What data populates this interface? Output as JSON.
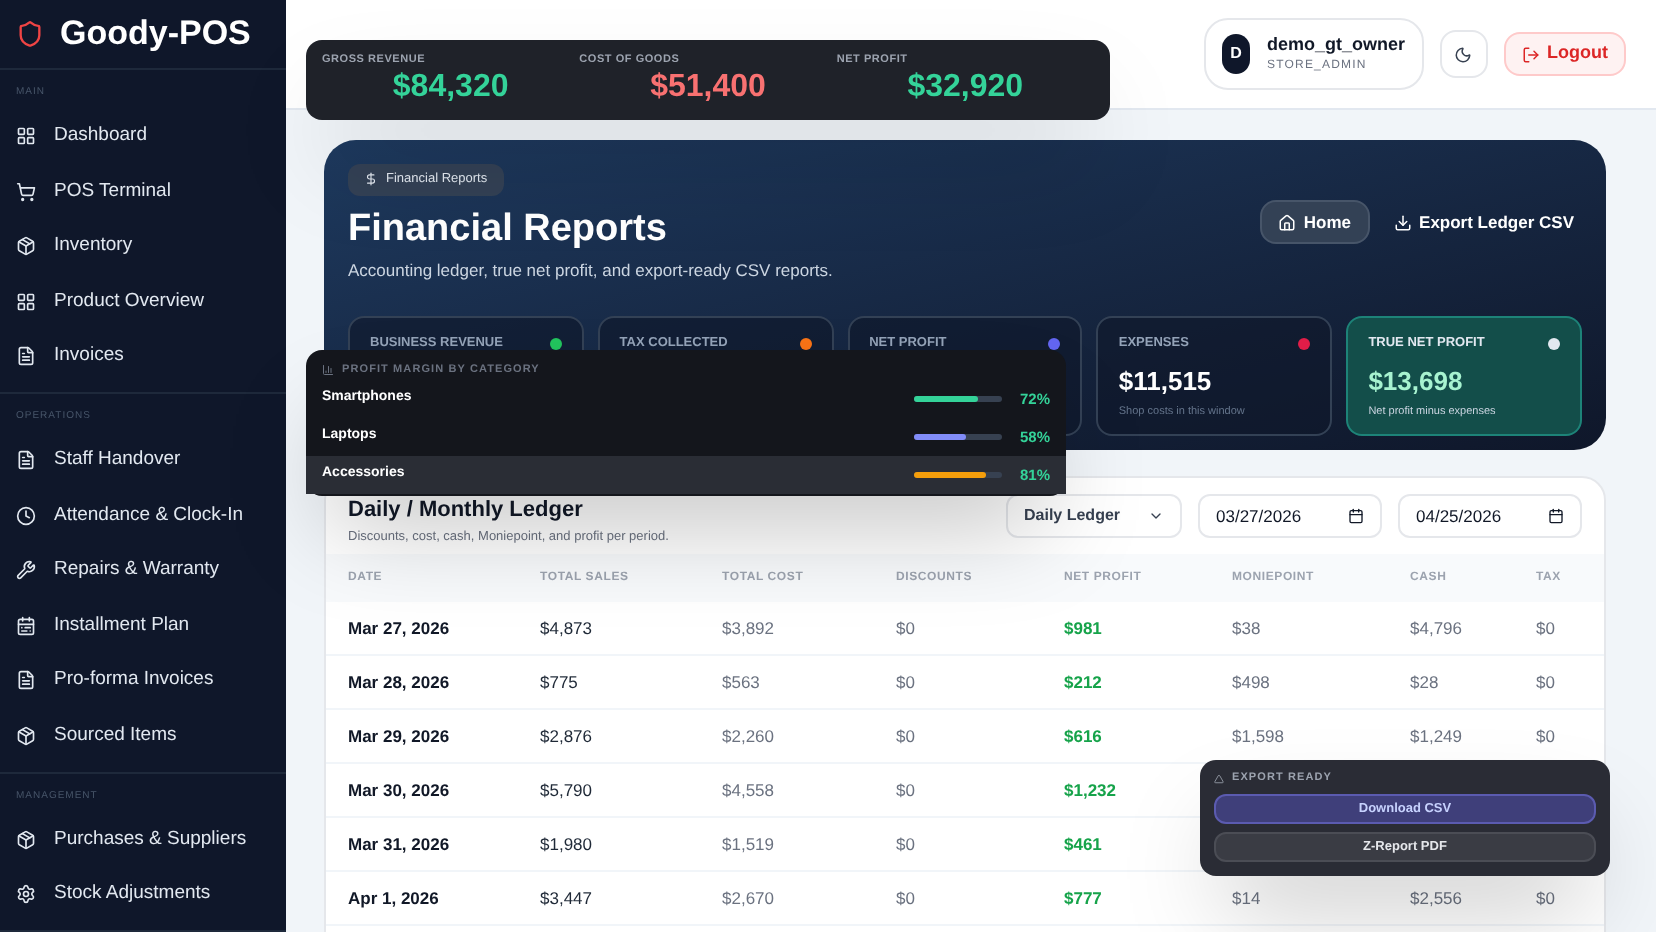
{
  "sidebar": {
    "brand": "Goody-POS",
    "sections": [
      {
        "title": "MAIN",
        "items": [
          {
            "label": "Dashboard"
          },
          {
            "label": "POS Terminal"
          },
          {
            "label": "Inventory"
          },
          {
            "label": "Product Overview"
          },
          {
            "label": "Invoices"
          }
        ]
      },
      {
        "title": "OPERATIONS",
        "items": [
          {
            "label": "Staff Handover"
          },
          {
            "label": "Attendance & Clock-In"
          },
          {
            "label": "Repairs & Warranty"
          },
          {
            "label": "Installment Plan"
          },
          {
            "label": "Pro-forma Invoices"
          },
          {
            "label": "Sourced Items"
          }
        ]
      },
      {
        "title": "MANAGEMENT",
        "items": [
          {
            "label": "Purchases & Suppliers"
          },
          {
            "label": "Stock Adjustments"
          }
        ]
      }
    ]
  },
  "summary_bar": [
    {
      "label": "GROSS REVENUE",
      "value": "$84,320",
      "color": "#34d399"
    },
    {
      "label": "COST OF GOODS",
      "value": "$51,400",
      "color": "#f87171"
    },
    {
      "label": "NET PROFIT",
      "value": "$32,920",
      "color": "#34d399"
    }
  ],
  "user": {
    "avatar": "D",
    "name": "demo_gt_owner",
    "role": "STORE_ADMIN"
  },
  "logout": "Logout",
  "hero": {
    "badge": "Financial Reports",
    "title": "Financial Reports",
    "subtitle": "Accounting ledger, true net profit, and export-ready CSV reports.",
    "home": "Home",
    "export": "Export Ledger CSV",
    "stats": [
      {
        "label": "BUSINESS REVENUE",
        "color": "#22c55e",
        "highlight": false
      },
      {
        "label": "TAX COLLECTED",
        "color": "#f97316",
        "highlight": false
      },
      {
        "label": "NET PROFIT",
        "color": "#6366f1",
        "highlight": false
      },
      {
        "label": "EXPENSES",
        "value": "$11,515",
        "note": "Shop costs in this window",
        "color": "#e11d48",
        "highlight": false
      },
      {
        "label": "TRUE NET PROFIT",
        "value": "$13,698",
        "note": "Net profit minus expenses",
        "color": "#e2e8f0",
        "highlight": true
      }
    ]
  },
  "margin_popup": {
    "title": "PROFIT MARGIN BY CATEGORY",
    "rows": [
      {
        "name": "Smartphones",
        "level": 0.72,
        "reading": "72%",
        "color": "#34d399",
        "selected": false
      },
      {
        "name": "Laptops",
        "level": 0.58,
        "reading": "58%",
        "color": "#818cf8",
        "selected": false
      },
      {
        "name": "Accessories",
        "level": 0.81,
        "reading": "81%",
        "color": "#f59e0b",
        "selected": true
      }
    ]
  },
  "ledger": {
    "title": "Daily / Monthly Ledger",
    "subtitle": "Discounts, cost, cash, Moniepoint, and profit per period.",
    "mode": "Daily Ledger",
    "from": "03/27/2026",
    "to": "04/25/2026",
    "columns": [
      "DATE",
      "TOTAL SALES",
      "TOTAL COST",
      "DISCOUNTS",
      "NET PROFIT",
      "MONIEPOINT",
      "CASH",
      "TAX"
    ],
    "rows": [
      {
        "date": "Mar 27, 2026",
        "sales": "$4,873",
        "cost": "$3,892",
        "discounts": "$0",
        "profit": "$981",
        "moniepoint": "$38",
        "cash": "$4,796",
        "tax": "$0"
      },
      {
        "date": "Mar 28, 2026",
        "sales": "$775",
        "cost": "$563",
        "discounts": "$0",
        "profit": "$212",
        "moniepoint": "$498",
        "cash": "$28",
        "tax": "$0"
      },
      {
        "date": "Mar 29, 2026",
        "sales": "$2,876",
        "cost": "$2,260",
        "discounts": "$0",
        "profit": "$616",
        "moniepoint": "$1,598",
        "cash": "$1,249",
        "tax": "$0"
      },
      {
        "date": "Mar 30, 2026",
        "sales": "$5,790",
        "cost": "$4,558",
        "discounts": "$0",
        "profit": "$1,232"
      },
      {
        "date": "Mar 31, 2026",
        "sales": "$1,980",
        "cost": "$1,519",
        "discounts": "$0",
        "profit": "$461"
      },
      {
        "date": "Apr 1, 2026",
        "sales": "$3,447",
        "cost": "$2,670",
        "discounts": "$0",
        "profit": "$777",
        "moniepoint": "$14",
        "cash": "$2,556",
        "tax": "$0"
      }
    ]
  },
  "export_popup": {
    "title": "EXPORT READY",
    "buttons": [
      {
        "label": "Download CSV",
        "kind": "primary"
      },
      {
        "label": "Z-Report PDF",
        "kind": "secondary"
      }
    ]
  }
}
